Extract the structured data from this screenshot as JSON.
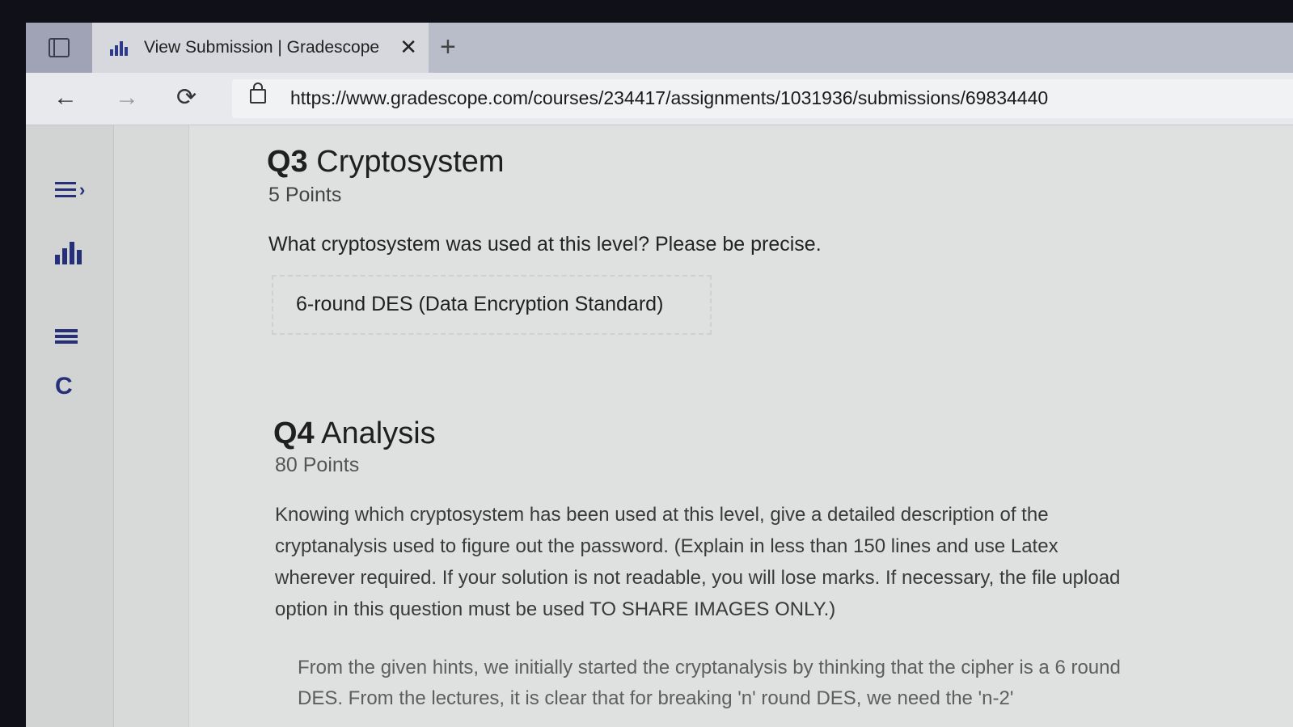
{
  "browser": {
    "tab_title": "View Submission | Gradescope",
    "close_tab": "✕",
    "new_tab": "+",
    "back": "←",
    "forward": "→",
    "reload": "⟳",
    "url": "https://www.gradescope.com/courses/234417/assignments/1031936/submissions/69834440"
  },
  "rail": {
    "reload_glyph": "C"
  },
  "q3": {
    "number": "Q3",
    "title": "Cryptosystem",
    "points": "5 Points",
    "prompt": "What cryptosystem was used at this level? Please be precise.",
    "answer": "6-round DES (Data Encryption Standard)"
  },
  "q4": {
    "number": "Q4",
    "title": "Analysis",
    "points": "80 Points",
    "prompt": "Knowing which cryptosystem has been used at this level, give a detailed description of the cryptanalysis used to figure out the password. (Explain in less than 150 lines and use Latex wherever required. If your solution is not readable, you will lose marks. If necessary, the file upload option in this question must be used TO SHARE IMAGES ONLY.)",
    "answer_excerpt": "From the given hints, we initially started the cryptanalysis by thinking that the cipher is a 6 round DES. From the lectures, it is clear that for breaking 'n' round DES, we need the 'n-2'"
  }
}
